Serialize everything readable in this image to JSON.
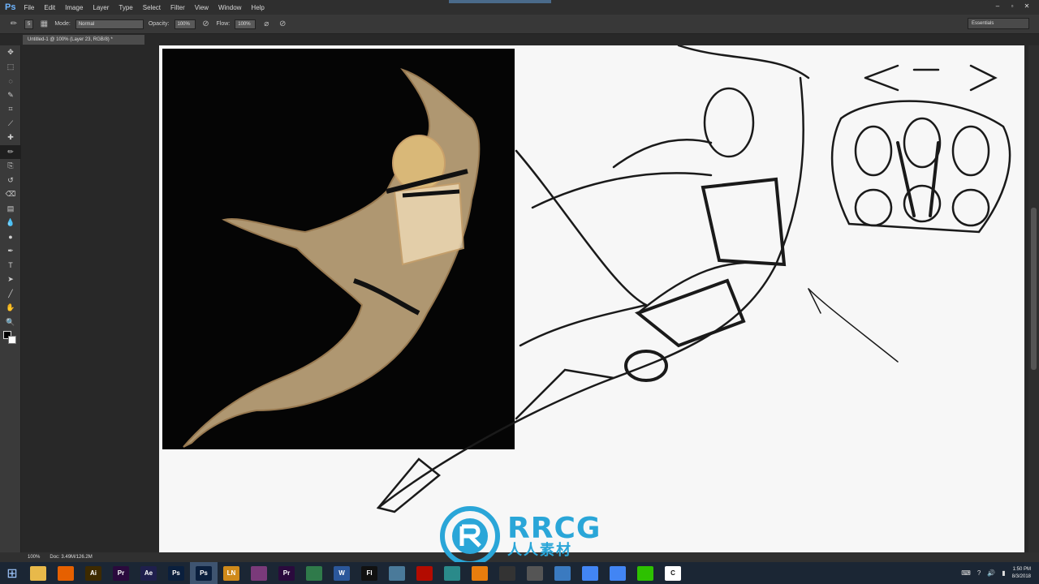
{
  "app": {
    "logo": "Ps"
  },
  "menu": [
    "File",
    "Edit",
    "Image",
    "Layer",
    "Type",
    "Select",
    "Filter",
    "View",
    "Window",
    "Help"
  ],
  "window_controls": [
    "–",
    "▫",
    "✕"
  ],
  "options_bar": {
    "brush_size": "5",
    "mode_label": "Mode:",
    "mode_value": "Normal",
    "opacity_label": "Opacity:",
    "opacity_value": "100%",
    "flow_label": "Flow:",
    "flow_value": "100%",
    "workspace": "Essentials"
  },
  "document_tab": {
    "title": "Untitled-1 @ 100% (Layer 23, RGB/8) *"
  },
  "status_bar": {
    "zoom": "100%",
    "doc_size": "Doc: 3.49M/126.2M"
  },
  "tools": [
    "move-tool",
    "marquee-tool",
    "lasso-tool",
    "quick-selection-tool",
    "crop-tool",
    "eyedropper-tool",
    "healing-brush-tool",
    "brush-tool",
    "clone-stamp-tool",
    "history-brush-tool",
    "eraser-tool",
    "gradient-tool",
    "blur-tool",
    "dodge-tool",
    "pen-tool",
    "type-tool",
    "path-selection-tool",
    "line-tool",
    "hand-tool",
    "zoom-tool"
  ],
  "tool_glyphs": [
    "✥",
    "⬚",
    "◌",
    "✎",
    "⌗",
    "⟋",
    "✚",
    "✏",
    "⎘",
    "↺",
    "⌫",
    "▤",
    "💧",
    "●",
    "✒",
    "T",
    "➤",
    "╱",
    "✋",
    "🔍"
  ],
  "taskbar": {
    "apps": [
      {
        "name": "file-explorer",
        "label": "",
        "color": "#e8b94a"
      },
      {
        "name": "firefox",
        "label": "",
        "color": "#e66000"
      },
      {
        "name": "illustrator",
        "label": "Ai",
        "color": "#3d2a00"
      },
      {
        "name": "premiere",
        "label": "Pr",
        "color": "#2a0a3d"
      },
      {
        "name": "after-effects",
        "label": "Ae",
        "color": "#1f1f4d"
      },
      {
        "name": "photoshop-1",
        "label": "Ps",
        "color": "#0a1f3d"
      },
      {
        "name": "photoshop-2",
        "label": "Ps",
        "color": "#0a1f3d"
      },
      {
        "name": "lightning-app",
        "label": "LN",
        "color": "#d08a1a"
      },
      {
        "name": "winrar",
        "label": "",
        "color": "#7a3a7a"
      },
      {
        "name": "premiere-2",
        "label": "Pr",
        "color": "#2a0a3d"
      },
      {
        "name": "calculator",
        "label": "",
        "color": "#2f7a4a"
      },
      {
        "name": "word",
        "label": "W",
        "color": "#2b579a"
      },
      {
        "name": "final-cut",
        "label": "Fl",
        "color": "#111111"
      },
      {
        "name": "notes-app",
        "label": "",
        "color": "#4a7a9a"
      },
      {
        "name": "acrobat",
        "label": "",
        "color": "#b30b00"
      },
      {
        "name": "maps-app",
        "label": "",
        "color": "#2a8a8a"
      },
      {
        "name": "blender",
        "label": "",
        "color": "#e87d0d"
      },
      {
        "name": "steam",
        "label": "",
        "color": "#333333"
      },
      {
        "name": "app-three-d",
        "label": "",
        "color": "#555555"
      },
      {
        "name": "remote-desktop",
        "label": "",
        "color": "#3a7ac0"
      },
      {
        "name": "chrome-1",
        "label": "",
        "color": "#4285f4"
      },
      {
        "name": "chrome-2",
        "label": "",
        "color": "#4285f4"
      },
      {
        "name": "wechat",
        "label": "",
        "color": "#2dc100"
      },
      {
        "name": "camtasia",
        "label": "C",
        "color": "#ffffff"
      }
    ],
    "clock_time": "1:50 PM",
    "clock_date": "8/3/2018"
  },
  "watermark": {
    "title": "RRCG",
    "subtitle": "人人素材"
  },
  "colors": {
    "canvas": "#f7f7f7",
    "pasteboard": "#282828",
    "accent": "#2aa6d8"
  }
}
